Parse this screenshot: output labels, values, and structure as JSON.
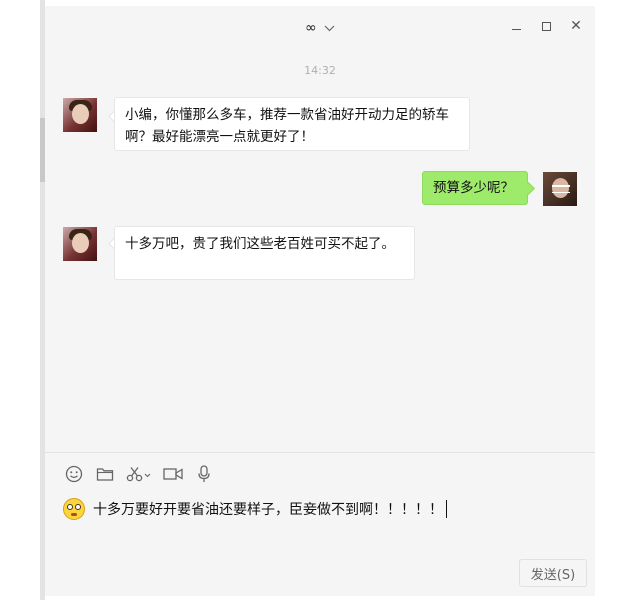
{
  "window": {
    "title": "∞",
    "controls": {
      "minimize_icon": "minimize-icon",
      "maximize_icon": "maximize-icon",
      "close_icon": "close-icon",
      "close_glyph": "✕"
    }
  },
  "chat": {
    "timestamp": "14:32",
    "messages": [
      {
        "sender": "other",
        "text_lines": [
          "小编，你懂那么多车，推荐一款省油好开动力足的轿车",
          "啊？最好能漂亮一点就更好了！"
        ]
      },
      {
        "sender": "me",
        "text_lines": [
          "预算多少呢？"
        ]
      },
      {
        "sender": "other",
        "text_lines": [
          "十多万吧，贵了我们这些老百姓可买不起了。"
        ]
      }
    ]
  },
  "toolbar": {
    "icons": [
      "emoji-icon",
      "folder-icon",
      "scissors-icon",
      "video-call-icon",
      "microphone-icon"
    ]
  },
  "composer": {
    "emoji": "flushed-face-emoji",
    "text": "十多万要好开要省油还要样子，臣妾做不到啊！！！！！"
  },
  "send_button": {
    "label": "发送(S)"
  },
  "colors": {
    "self_bubble": "#9eea6a",
    "other_bubble": "#ffffff",
    "window_bg": "#f5f5f5"
  }
}
